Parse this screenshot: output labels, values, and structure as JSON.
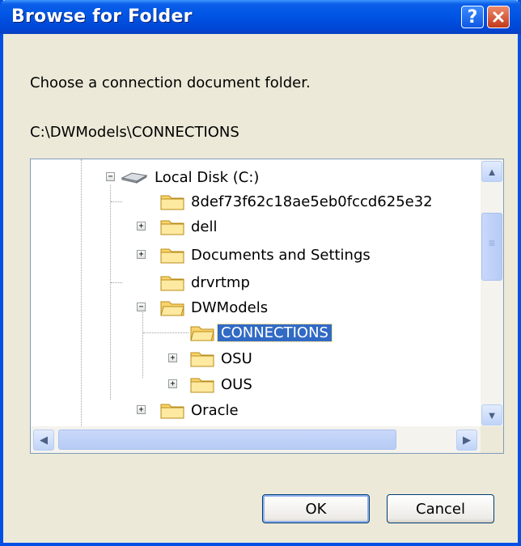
{
  "dialog": {
    "title": "Browse for Folder",
    "help_label": "?",
    "close_label": "✕",
    "instruction": "Choose a connection document folder.",
    "path": "C:\\DWModels\\CONNECTIONS"
  },
  "tree": {
    "items": [
      {
        "label": "Local Disk (C:)",
        "expand": "−"
      },
      {
        "label": "8def73f62c18ae5eb0fccd625e32",
        "expand": ""
      },
      {
        "label": "dell",
        "expand": "+"
      },
      {
        "label": "Documents and Settings",
        "expand": "+"
      },
      {
        "label": "drvrtmp",
        "expand": ""
      },
      {
        "label": "DWModels",
        "expand": "−"
      },
      {
        "label": "CONNECTIONS",
        "expand": ""
      },
      {
        "label": "OSU",
        "expand": "+"
      },
      {
        "label": "OUS",
        "expand": "+"
      },
      {
        "label": "Oracle",
        "expand": "+"
      }
    ]
  },
  "scrollbar": {
    "up": "▲",
    "down": "▼",
    "left": "◀",
    "right": "▶",
    "grip": "≡"
  },
  "buttons": {
    "ok": "OK",
    "cancel": "Cancel"
  },
  "colors": {
    "titlebar": "#0055e5",
    "selection": "#316ac5",
    "dialog_bg": "#ece9d8"
  }
}
